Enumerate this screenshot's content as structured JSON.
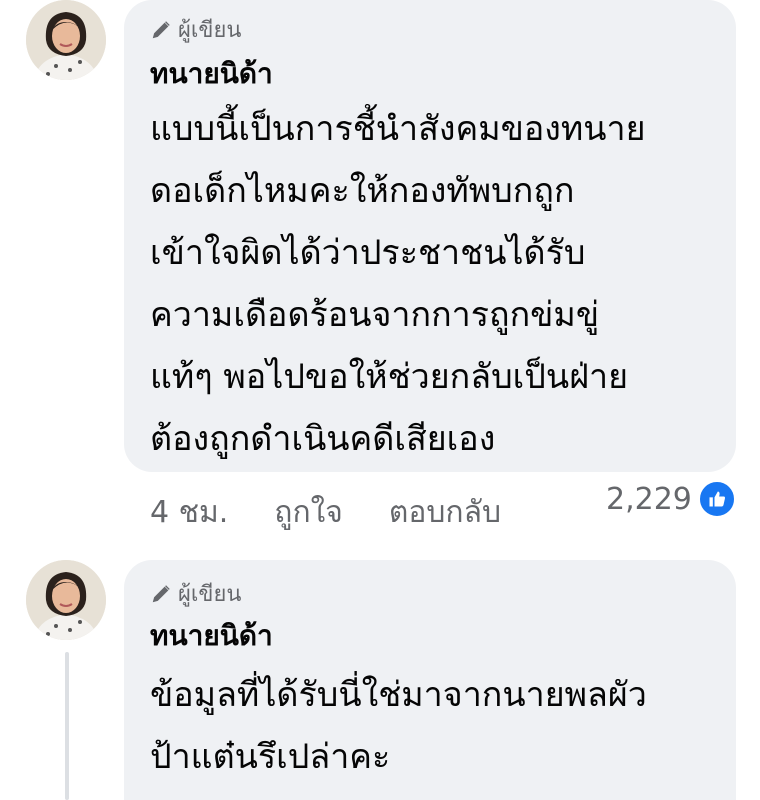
{
  "comments": [
    {
      "badge": "ผู้เขียน",
      "author": "ทนายนิด้า",
      "lines": [
        "แบบนี้เป็นการชี้นำสังคมของทนาย",
        "ดอเด็กไหมคะให้กองทัพบกถูก",
        "เข้าใจผิดได้ว่าประชาชนได้รับ",
        "ความเดือดร้อนจากการถูกข่มขู่",
        "แท้ๆ พอไปขอให้ช่วยกลับเป็นฝ่าย",
        "ต้องถูกดำเนินคดีเสียเอง"
      ],
      "time": "4 ชม.",
      "like_label": "ถูกใจ",
      "reply_label": "ตอบกลับ",
      "reaction_count": "2,229",
      "reaction_icon": "thumbs-up-icon",
      "reaction_color": "#1877f2"
    },
    {
      "badge": "ผู้เขียน",
      "author": "ทนายนิด้า",
      "lines": [
        "ข้อมูลที่ได้รับนี่ใช่มาจากนายพลผัว",
        "ป้าแต๋นรึเปล่าคะ"
      ]
    }
  ]
}
